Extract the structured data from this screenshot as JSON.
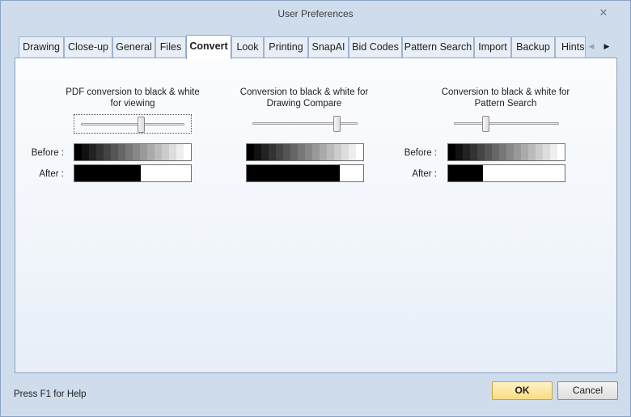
{
  "window": {
    "title": "User Preferences"
  },
  "tabs": [
    {
      "label": "Drawing"
    },
    {
      "label": "Close-up"
    },
    {
      "label": "General"
    },
    {
      "label": "Files"
    },
    {
      "label": "Convert",
      "active": true
    },
    {
      "label": "Look"
    },
    {
      "label": "Printing"
    },
    {
      "label": "SnapAI"
    },
    {
      "label": "Bid Codes"
    },
    {
      "label": "Pattern Search"
    },
    {
      "label": "Import"
    },
    {
      "label": "Backup"
    },
    {
      "label": "Hints"
    }
  ],
  "labels": {
    "before": "Before :",
    "after": "After :"
  },
  "groups": [
    {
      "title": "PDF conversion to black & white for viewing",
      "threshold": 0.57,
      "show_before_after_labels": true,
      "focused": true
    },
    {
      "title": "Conversion to black & white for Drawing Compare",
      "threshold": 0.8,
      "show_before_after_labels": false,
      "focused": false
    },
    {
      "title": "Conversion to black & white for Pattern Search",
      "threshold": 0.3,
      "show_before_after_labels": true,
      "focused": false
    }
  ],
  "gradient_levels": 16,
  "footer": {
    "help_text": "Press F1 for Help",
    "ok_label": "OK",
    "cancel_label": "Cancel"
  },
  "colors": {
    "accent_ok": "#f8dc83",
    "panel_border": "#8aa3c4",
    "window_bg": "#cfdcec"
  }
}
